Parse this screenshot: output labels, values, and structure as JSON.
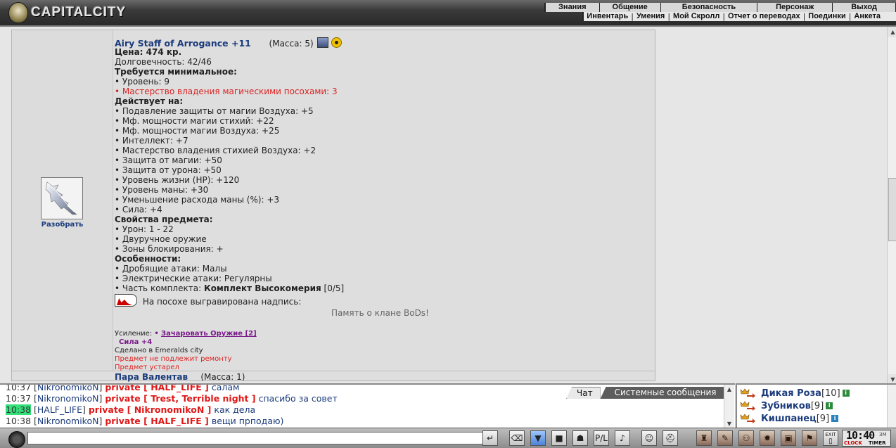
{
  "header": {
    "logo_text": "CAPITALCITY",
    "menu_main": [
      "Знания",
      "Общение",
      "Безопасность",
      "Персонаж",
      "Выход"
    ],
    "menu_sub": [
      "Инвентарь",
      "Умения",
      "Мой Скролл",
      "Отчет о переводах",
      "Поединки",
      "Анкета"
    ]
  },
  "item": {
    "name": "Airy Staff of Arrogance +11",
    "mass": "(Масса: 5)",
    "disassemble_label": "Разобрать",
    "price": "Цена: 474 кр.",
    "durability": "Долговечность: 42/46",
    "requires_heading": "Требуется минимальное:",
    "requires": [
      {
        "text": "• Уровень: 9",
        "unmet": false
      },
      {
        "text": "• Мастерство владения магическими посохами: 3",
        "unmet": true
      }
    ],
    "effects_heading": "Действует на:",
    "effects": [
      "• Подавление защиты от магии Воздуха: +5",
      "• Мф. мощности магии стихий: +22",
      "• Мф. мощности магии Воздуха: +25",
      "• Интеллект: +7",
      "• Мастерство владения стихией Воздуха: +2",
      "• Защита от магии: +50",
      "• Защита от урона: +50",
      "• Уровень жизни (HP): +120",
      "• Уровень маны: +30",
      "• Уменьшение расхода маны (%): +3",
      "• Сила: +4"
    ],
    "props_heading": "Свойства предмета:",
    "props": [
      "• Урон: 1 - 22",
      "• Двуручное оружие",
      "• Зоны блокирования: +"
    ],
    "features_heading": "Особенности:",
    "features": [
      "• Дробящие атаки: Малы",
      "• Электрические атаки: Регулярны"
    ],
    "set_prefix": "• Часть комплекта: ",
    "set_name": "Комплект Высокомерия",
    "set_count": " [0/5]",
    "engraving_label": "На посохе выгравирована надпись:",
    "engraving_text": "Память о клане BoDs!",
    "upgrade_label": "Усиление: ",
    "upgrade_bullet": "•",
    "upgrade_link": "Зачаровать Оружие [2]",
    "upgrade_value": "Сила +4",
    "made_in": "Сделано в Emeralds city",
    "no_repair": "Предмет не подлежит ремонту",
    "expired": "Предмет устарел",
    "next_item_partial": "Пара Валентав",
    "next_item_mass": "(Масса: 1)"
  },
  "chat": {
    "tabs": [
      "Чат",
      "Системные сообщения"
    ],
    "messages": [
      {
        "time": "10:37",
        "nick": "NikronomikoN",
        "priv": "private [ HALF_LIFE ]",
        "text": "салам",
        "hl": false
      },
      {
        "time": "10:37",
        "nick": "NikronomikoN",
        "priv": "private [ Trest, Terrible night ]",
        "text": "спасибо за совет",
        "hl": false
      },
      {
        "time": "10:38",
        "nick": "HALF_LIFE",
        "priv": "private [ NikronomikoN ]",
        "text": "как дела",
        "hl": true
      },
      {
        "time": "10:38",
        "nick": "NikronomikoN",
        "priv": "private [ HALF_LIFE ]",
        "text": "вещи прподаю)",
        "hl": false
      }
    ]
  },
  "online": [
    {
      "name": "Дикая Роза",
      "level": "[10]",
      "info": "i"
    },
    {
      "name": "Зубников",
      "level": "[9]",
      "info": "i"
    },
    {
      "name": "Кишпанец",
      "level": "[9]",
      "info": "i"
    }
  ],
  "toolbar": {
    "input_value": "",
    "clock_time": "10:40",
    "clock_suffix": "ЗМ",
    "clock_label": "CLOCK",
    "timer_label": "TIMER",
    "exit_label": "EXIT"
  },
  "colors": {
    "link_blue": "#1c3c7c",
    "unmet_red": "#d22",
    "private_red": "#e01818",
    "highlight_green": "#33e07a"
  }
}
